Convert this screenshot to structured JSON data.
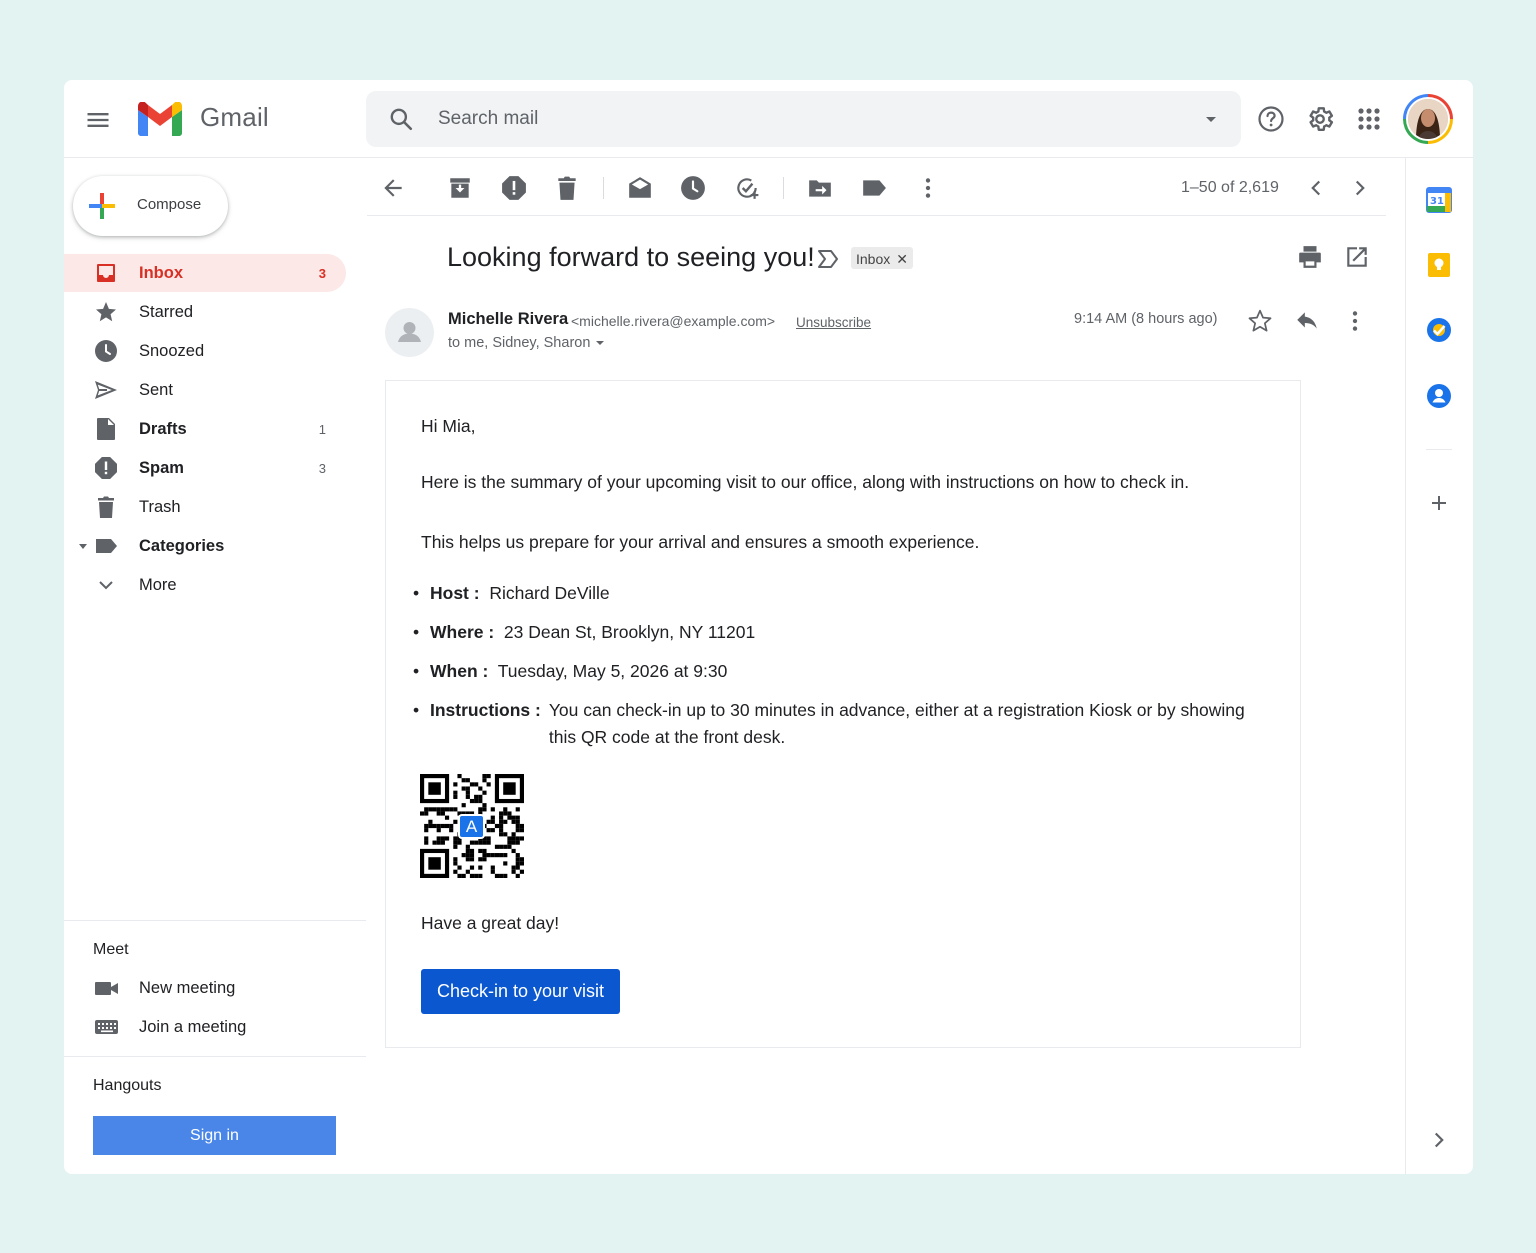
{
  "app": {
    "brand": "Gmail"
  },
  "search": {
    "placeholder": "Search mail"
  },
  "compose": {
    "label": "Compose"
  },
  "sidebar": {
    "items": [
      {
        "label": "Inbox",
        "count": "3",
        "bold": true,
        "active": true
      },
      {
        "label": "Starred",
        "count": ""
      },
      {
        "label": "Snoozed",
        "count": ""
      },
      {
        "label": "Sent",
        "count": ""
      },
      {
        "label": "Drafts",
        "count": "1",
        "bold": true
      },
      {
        "label": "Spam",
        "count": "3",
        "bold": true
      },
      {
        "label": "Trash",
        "count": ""
      },
      {
        "label": "Categories",
        "count": "",
        "bold": true
      },
      {
        "label": "More",
        "count": ""
      }
    ]
  },
  "meet": {
    "title": "Meet",
    "new_meeting": "New meeting",
    "join_meeting": "Join a meeting"
  },
  "hangouts": {
    "title": "Hangouts",
    "sign_in": "Sign in"
  },
  "toolbar": {
    "pager": "1–50 of 2,619"
  },
  "email": {
    "subject": "Looking forward to seeing you!",
    "label": "Inbox",
    "sender_name": "Michelle Rivera",
    "sender_email": "<michelle.rivera@example.com>",
    "unsubscribe": "Unsubscribe",
    "recipients": "to me, Sidney, Sharon",
    "time": "9:14 AM  (8 hours ago)",
    "greeting": "Hi Mia,",
    "para1": "Here is the summary of your upcoming visit to our office, along with instructions on how to check in.",
    "para2": "This helps us prepare for your arrival and ensures a smooth experience.",
    "details": [
      {
        "key": "Host :",
        "value": "Richard DeVille"
      },
      {
        "key": "Where :",
        "value": "23 Dean St, Brooklyn, NY 11201"
      },
      {
        "key": "When :",
        "value": "Tuesday, May 5, 2026 at 9:30"
      },
      {
        "key": "Instructions :",
        "value": "You can check-in up to 30 minutes in advance, either at a registration Kiosk or by showing this QR code at the front desk."
      }
    ],
    "qr_badge": "A",
    "signoff": "Have a great day!",
    "cta": "Check-in to your visit"
  },
  "colors": {
    "red": "#d93025",
    "blue": "#0b57d0",
    "signin": "#4a86e8",
    "bg": "#e3f3f1"
  }
}
